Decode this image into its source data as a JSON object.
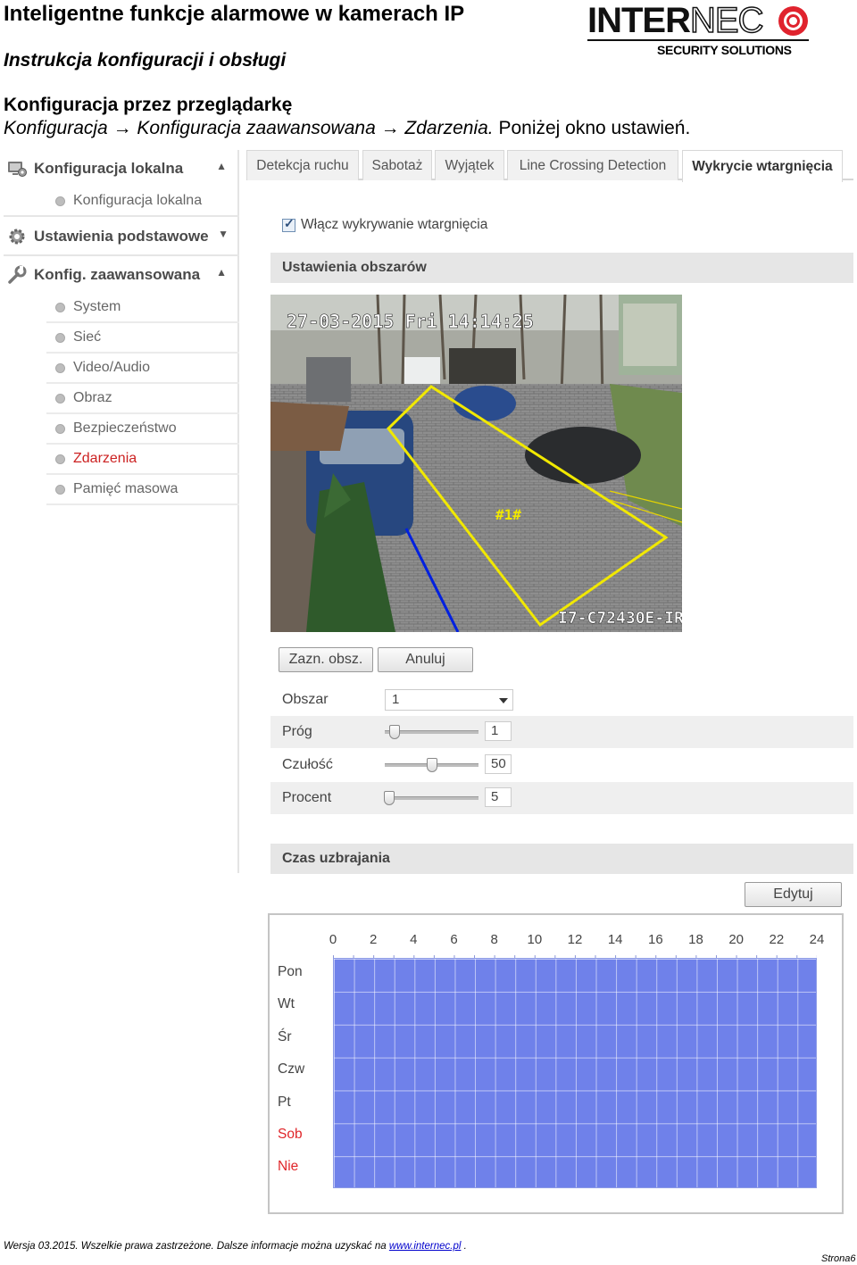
{
  "document": {
    "title": "Inteligentne funkcje alarmowe w kamerach IP",
    "subtitle": "Instrukcja konfiguracji i obsługi",
    "section_heading": "Konfiguracja przez przeglądarkę",
    "breadcrumb": {
      "part1": "Konfiguracja → Konfiguracja zaawansowana → Zdarzenia.",
      "part2": " Poniżej okno ustawień."
    }
  },
  "logo": {
    "brand_bold": "INTER",
    "brand_outline": "NEC",
    "tagline": "SECURITY  SOLUTIONS"
  },
  "sidebar": {
    "local_config": {
      "label": "Konfiguracja lokalna",
      "icon": "monitor-gear-icon",
      "items": [
        "Konfiguracja lokalna"
      ]
    },
    "basic_settings": {
      "label": "Ustawienia podstawowe",
      "icon": "gear-icon"
    },
    "advanced_config": {
      "label": "Konfig. zaawansowana",
      "icon": "wrench-icon",
      "items": [
        "System",
        "Sieć",
        "Video/Audio",
        "Obraz",
        "Bezpieczeństwo",
        "Zdarzenia",
        "Pamięć masowa"
      ],
      "active_item": "Zdarzenia"
    }
  },
  "tabs": [
    "Detekcja ruchu",
    "Sabotaż",
    "Wyjątek",
    "Line Crossing Detection",
    "Wykrycie wtargnięcia"
  ],
  "active_tab": "Wykrycie wtargnięcia",
  "enable_checkbox": {
    "label": "Włącz wykrywanie wtargnięcia",
    "checked": true
  },
  "area_settings": {
    "header": "Ustawienia obszarów",
    "camera": {
      "timestamp": "27-03-2015 Fri 14:14:25",
      "zone_label": "#1#",
      "camera_name": "I7-C72430E-IR"
    },
    "buttons": {
      "draw": "Zazn. obsz.",
      "cancel": "Anuluj"
    },
    "params": {
      "area": {
        "label": "Obszar",
        "value": "1"
      },
      "threshold": {
        "label": "Próg",
        "value": "1",
        "level": 0.1
      },
      "sensitivity": {
        "label": "Czułość",
        "value": "50",
        "level": 0.5
      },
      "percent": {
        "label": "Procent",
        "value": "5",
        "level": 0.05
      }
    }
  },
  "schedule": {
    "header": "Czas uzbrajania",
    "edit_button": "Edytuj",
    "hours": [
      "0",
      "2",
      "4",
      "6",
      "8",
      "10",
      "12",
      "14",
      "16",
      "18",
      "20",
      "22",
      "24"
    ],
    "days": [
      "Pon",
      "Wt",
      "Śr",
      "Czw",
      "Pt",
      "Sob",
      "Nie"
    ],
    "weekend_days": [
      "Sob",
      "Nie"
    ],
    "armed_all_day": true,
    "armed_color": "#6f81ea",
    "weekend_color": "#e0262a"
  },
  "footer": {
    "text": "Wersja  03.2015. Wszelkie prawa zastrzeżone. Dalsze informacje można uzyskać na ",
    "link": "www.internec.pl",
    "suffix": " .",
    "page_label": "Strona6"
  }
}
